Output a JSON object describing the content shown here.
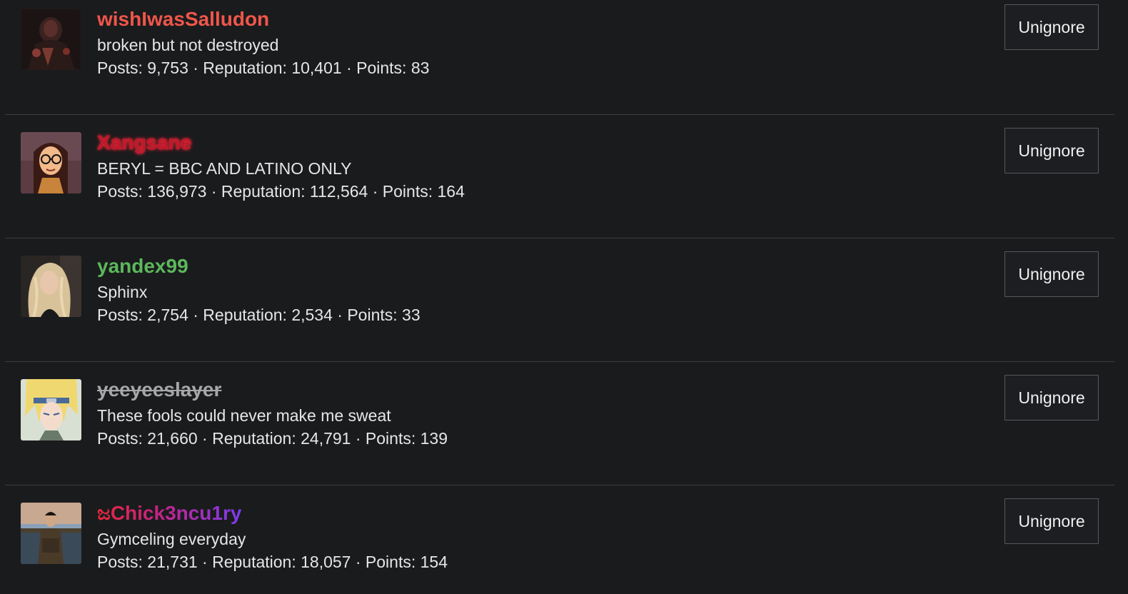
{
  "users": [
    {
      "name": "wishIwasSalludon",
      "name_color": "#f0564a",
      "user_title": "broken but not destroyed",
      "stats": "Posts: 9,753 · Reputation: 10,401 · Points: 83",
      "avatar_icon": "dark-figure-avatar",
      "button": "Unignore"
    },
    {
      "name": "Xangsane",
      "name_color": "#c0182a",
      "user_title": "BERYL = BBC AND LATINO ONLY",
      "stats": "Posts: 136,973 · Reputation: 112,564 · Points: 164",
      "avatar_icon": "cartoon-girl-glasses-avatar",
      "button": "Unignore"
    },
    {
      "name": "yandex99",
      "name_color": "#5cb85c",
      "user_title": "Sphinx",
      "stats": "Posts: 2,754 · Reputation: 2,534 · Points: 33",
      "avatar_icon": "blonde-woman-avatar",
      "button": "Unignore"
    },
    {
      "name": "yeeyeeslayer",
      "name_color": "#a6a7a8",
      "user_title": "These fools could never make me sweat",
      "stats": "Posts: 21,660 · Reputation: 24,791 · Points: 139",
      "avatar_icon": "anime-character-avatar",
      "button": "Unignore"
    },
    {
      "name": "ಜChick3ncu1ry",
      "name_color": "#c2248a",
      "user_title": "Gymceling everyday",
      "stats": "Posts: 21,731 · Reputation: 18,057 · Points: 154",
      "avatar_icon": "man-sunset-avatar",
      "button": "Unignore"
    }
  ]
}
